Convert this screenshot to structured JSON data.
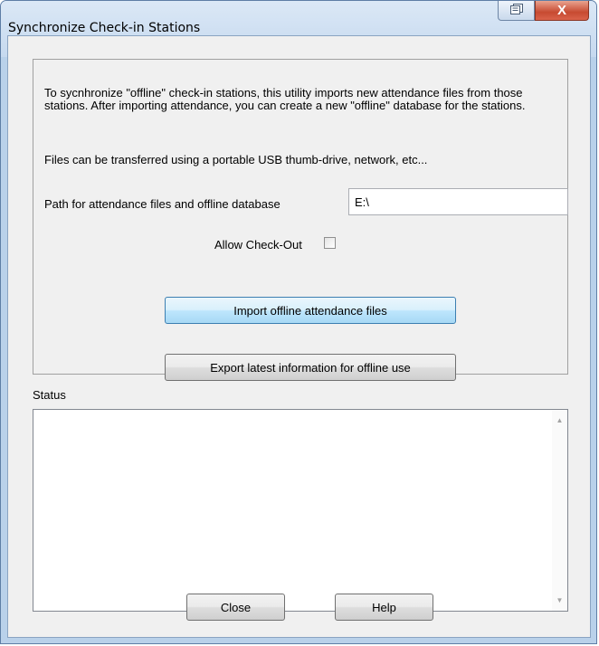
{
  "window": {
    "title": "Synchronize Check-in Stations",
    "help_icon": "context-help-icon",
    "close_glyph": "X"
  },
  "intro": {
    "paragraph1": "To sycnhronize \"offline\" check-in stations, this utility imports new attendance files from those stations.  After importing attendance, you can create a new \"offline\" database for the stations.",
    "paragraph2": "Files can be transferred using a portable USB thumb-drive, network, etc..."
  },
  "path": {
    "label": "Path for attendance files and offline database",
    "value": "E:\\"
  },
  "checkout": {
    "label": "Allow Check-Out",
    "checked": false
  },
  "buttons": {
    "import_label": "Import offline attendance files",
    "export_label": "Export latest information for offline use",
    "close_label": "Close",
    "help_label": "Help"
  },
  "status": {
    "label": "Status",
    "text": ""
  }
}
